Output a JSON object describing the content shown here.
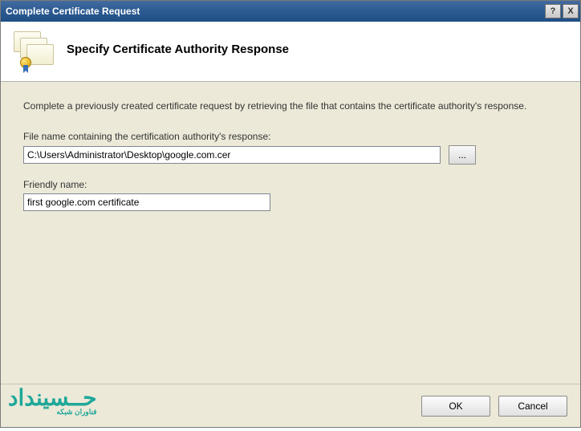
{
  "titlebar": {
    "title": "Complete Certificate Request",
    "help_label": "?",
    "close_label": "X"
  },
  "header": {
    "heading": "Specify Certificate Authority Response"
  },
  "body": {
    "description": "Complete a previously created certificate request by retrieving the file that contains the certificate authority's response.",
    "filepath_label": "File name containing the certification authority's response:",
    "filepath_value": "C:\\Users\\Administrator\\Desktop\\google.com.cer",
    "browse_label": "...",
    "friendly_label": "Friendly name:",
    "friendly_value": "first google.com certificate"
  },
  "footer": {
    "ok_label": "OK",
    "cancel_label": "Cancel"
  },
  "watermark": {
    "main": "حــسينداد",
    "sub": "فناوران شبکه"
  }
}
